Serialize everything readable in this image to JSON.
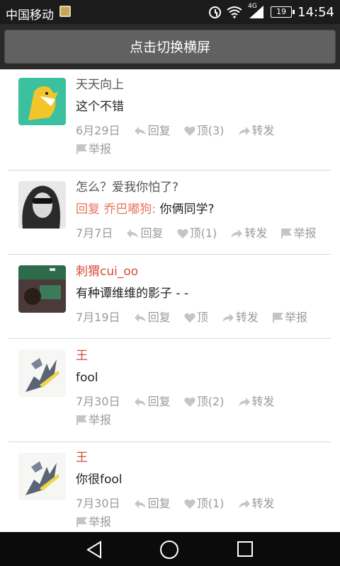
{
  "status_bar": {
    "carrier": "中国移动",
    "network": "4G",
    "battery": "19",
    "time": "14:54"
  },
  "header": {
    "toggle_label": "点击切换横屏"
  },
  "comments": [
    {
      "name": "天天向上",
      "name_red": false,
      "reply_prefix": "",
      "text": "这个不错",
      "date": "6月29日",
      "reply": "回复",
      "like": "顶(3)",
      "share": "转发",
      "report": "举报"
    },
    {
      "name": "怎么？爱我你怕了?",
      "name_red": false,
      "reply_prefix": "回复 乔巴嘟狗:",
      "text": "你俩同学?",
      "date": "7月7日",
      "reply": "回复",
      "like": "顶(1)",
      "share": "转发",
      "report": "举报"
    },
    {
      "name": "刺猬cui_oo",
      "name_red": true,
      "reply_prefix": "",
      "text": "有种谭维维的影子 - -",
      "date": "7月19日",
      "reply": "回复",
      "like": "顶",
      "share": "转发",
      "report": "举报"
    },
    {
      "name": "王",
      "name_red": true,
      "reply_prefix": "",
      "text": "fool",
      "date": "7月30日",
      "reply": "回复",
      "like": "顶(2)",
      "share": "转发",
      "report": "举报"
    },
    {
      "name": "王",
      "name_red": true,
      "reply_prefix": "",
      "text": "你很fool",
      "date": "7月30日",
      "reply": "回复",
      "like": "顶(1)",
      "share": "转发",
      "report": "举报"
    }
  ],
  "colors": {
    "name_red": "#d84a3a",
    "reply_prefix": "#e8735f",
    "meta": "#9a9a9a",
    "header_button": "#616161"
  },
  "icons": [
    "clock-icon",
    "wifi-icon",
    "signal-icon",
    "reply-arrow-icon",
    "heart-icon",
    "share-arrow-icon",
    "flag-icon",
    "back-icon",
    "home-icon",
    "recents-icon"
  ]
}
